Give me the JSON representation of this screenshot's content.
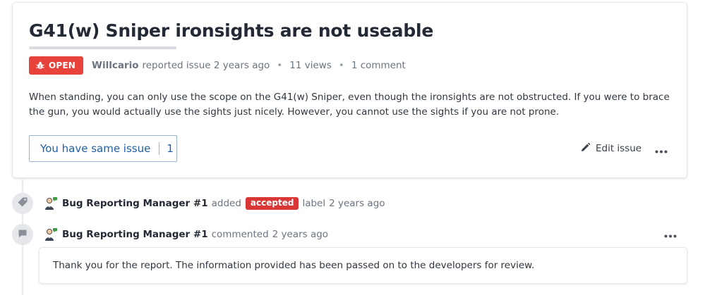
{
  "issue": {
    "title": "G41(w) Sniper ironsights are not useable",
    "status": "OPEN",
    "author": "Willcario",
    "reported_text": "reported issue 2 years ago",
    "views": "11 views",
    "comments": "1 comment",
    "separator": "•",
    "description": "When standing, you can only use the scope on the G41(w) Sniper, even though the ironsights are not obstructed. If you were to brace the gun, you would actually use the sights just nicely. However, you cannot use the sights if you are not prone.",
    "colors": {
      "status_badge": "#e8433a",
      "accent": "#1e5fa6"
    }
  },
  "actions": {
    "same_issue_label": "You have same issue",
    "same_issue_count": "1",
    "edit_label": "Edit issue",
    "more_icon": "ellipsis-icon",
    "edit_icon": "pencil-icon"
  },
  "timeline": [
    {
      "type": "label",
      "icon": "tag-icon",
      "actor": "Bug Reporting Manager #1",
      "verb": "added",
      "label": "accepted",
      "label_color": "#d93636",
      "suffix": "label",
      "time": "2 years ago"
    },
    {
      "type": "comment",
      "icon": "comment-icon",
      "actor": "Bug Reporting Manager #1",
      "verb": "commented",
      "time": "2 years ago",
      "body": "Thank you for the report. The information provided has been passed on to the developers for review."
    }
  ]
}
